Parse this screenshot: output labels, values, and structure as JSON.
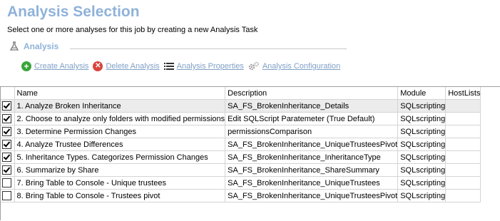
{
  "header": {
    "title": "Analysis Selection",
    "subtitle": "Select one or more analyses for this job by creating a new Analysis Task"
  },
  "section": {
    "label": "Analysis",
    "icon": "flask-icon"
  },
  "toolbar": {
    "create": {
      "label": "Create Analysis",
      "icon": "plus-circle-icon",
      "color": "#3aa53a"
    },
    "delete": {
      "label": "Delete Analysis",
      "icon": "x-circle-icon",
      "color": "#d9443b"
    },
    "properties": {
      "label": "Analysis Properties",
      "icon": "list-icon"
    },
    "configuration": {
      "label": "Analysis Configuration",
      "icon": "gears-icon"
    }
  },
  "table": {
    "columns": [
      "Name",
      "Description",
      "Module",
      "HostLists"
    ],
    "rows": [
      {
        "checked": true,
        "name": "1. Analyze Broken Inheritance",
        "description": "SA_FS_BrokenInheritance_Details",
        "module": "SQLscripting",
        "hostlists": ""
      },
      {
        "checked": true,
        "name": "2. Choose to analyze only folders with modified permissions",
        "description": "Edit SQLScript Paratemeter (True Default)",
        "module": "SQLscripting",
        "hostlists": ""
      },
      {
        "checked": true,
        "name": "3. Determine Permission Changes",
        "description": "permissionsComparison",
        "module": "SQLscripting",
        "hostlists": ""
      },
      {
        "checked": true,
        "name": "4. Analyze Trustee Differences",
        "description": "SA_FS_BrokenInheritance_UniqueTrusteesPivot",
        "module": "SQLscripting",
        "hostlists": ""
      },
      {
        "checked": true,
        "name": "5. Inheritance Types. Categorizes Permission Changes",
        "description": "SA_FS_BrokenInheritance_InheritanceType",
        "module": "SQLscripting",
        "hostlists": ""
      },
      {
        "checked": true,
        "name": "6. Summarize by Share",
        "description": "SA_FS_BrokenInheritance_ShareSummary",
        "module": "SQLscripting",
        "hostlists": ""
      },
      {
        "checked": false,
        "name": "7. Bring Table to Console - Unique trustees",
        "description": "SA_FS_BrokenInheritance_UniqueTrustees",
        "module": "SQLscripting",
        "hostlists": ""
      },
      {
        "checked": false,
        "name": "8. Bring Table to Console - Trustees pivot",
        "description": "SA_FS_BrokenInheritance_UniqueTrusteesPivot",
        "module": "SQLscripting",
        "hostlists": ""
      }
    ]
  }
}
